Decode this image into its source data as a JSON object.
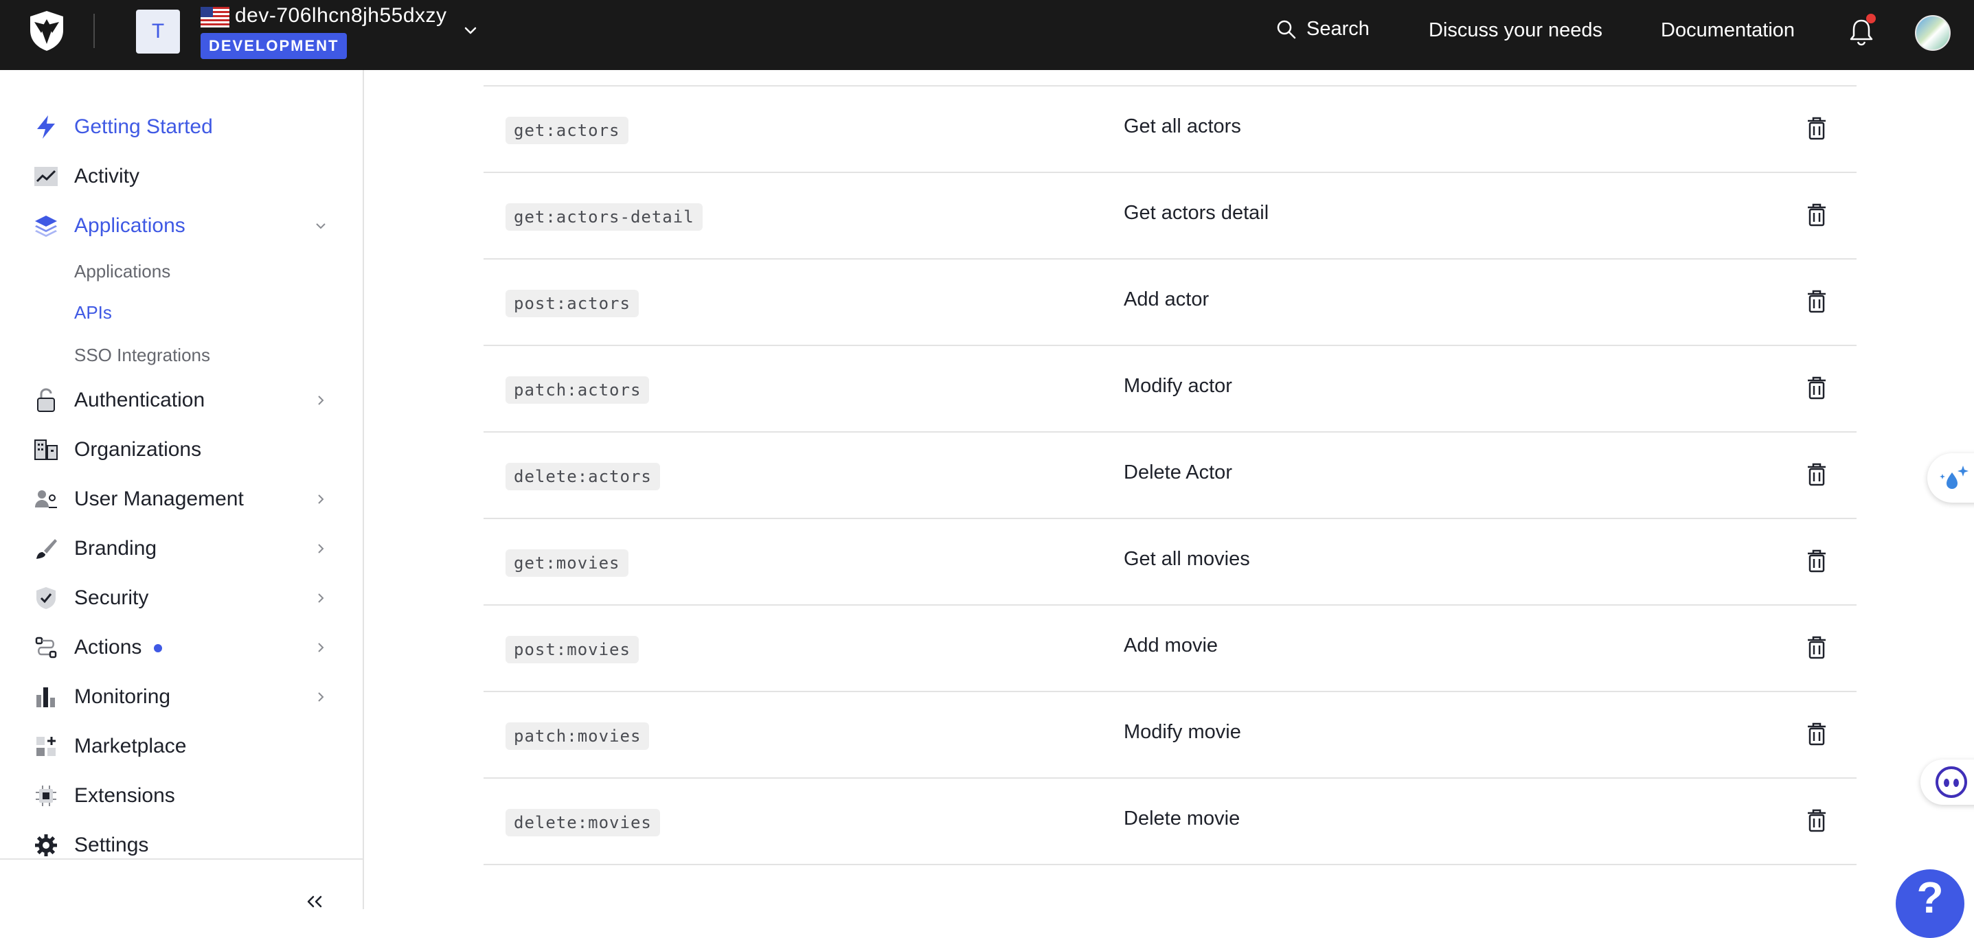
{
  "header": {
    "tenant_initial": "T",
    "tenant_name": "dev-706lhcn8jh55dxzy",
    "environment_badge": "DEVELOPMENT",
    "search_label": "Search",
    "discuss_label": "Discuss your needs",
    "docs_label": "Documentation"
  },
  "sidebar": {
    "items": [
      {
        "label": "Getting Started",
        "icon": "bolt-icon"
      },
      {
        "label": "Activity",
        "icon": "activity-chart-icon"
      },
      {
        "label": "Applications",
        "icon": "layers-icon"
      },
      {
        "label": "Authentication",
        "icon": "unlock-icon"
      },
      {
        "label": "Organizations",
        "icon": "buildings-icon"
      },
      {
        "label": "User Management",
        "icon": "users-icon"
      },
      {
        "label": "Branding",
        "icon": "brush-icon"
      },
      {
        "label": "Security",
        "icon": "shield-check-icon"
      },
      {
        "label": "Actions",
        "icon": "flow-icon"
      },
      {
        "label": "Monitoring",
        "icon": "bar-chart-icon"
      },
      {
        "label": "Marketplace",
        "icon": "grid-plus-icon"
      },
      {
        "label": "Extensions",
        "icon": "chip-icon"
      },
      {
        "label": "Settings",
        "icon": "gear-icon"
      }
    ],
    "sub_items": [
      {
        "label": "Applications"
      },
      {
        "label": "APIs"
      },
      {
        "label": "SSO Integrations"
      }
    ]
  },
  "permissions": [
    {
      "scope": "get:actors",
      "description": "Get all actors"
    },
    {
      "scope": "get:actors-detail",
      "description": "Get actors detail"
    },
    {
      "scope": "post:actors",
      "description": "Add actor"
    },
    {
      "scope": "patch:actors",
      "description": "Modify actor"
    },
    {
      "scope": "delete:actors",
      "description": "Delete Actor"
    },
    {
      "scope": "get:movies",
      "description": "Get all movies"
    },
    {
      "scope": "post:movies",
      "description": "Add movie"
    },
    {
      "scope": "patch:movies",
      "description": "Modify movie"
    },
    {
      "scope": "delete:movies",
      "description": "Delete movie"
    }
  ],
  "help": {
    "label": "?"
  },
  "colors": {
    "accent": "#3f59e4",
    "topbar": "#191919",
    "notification_dot": "#e53935"
  }
}
